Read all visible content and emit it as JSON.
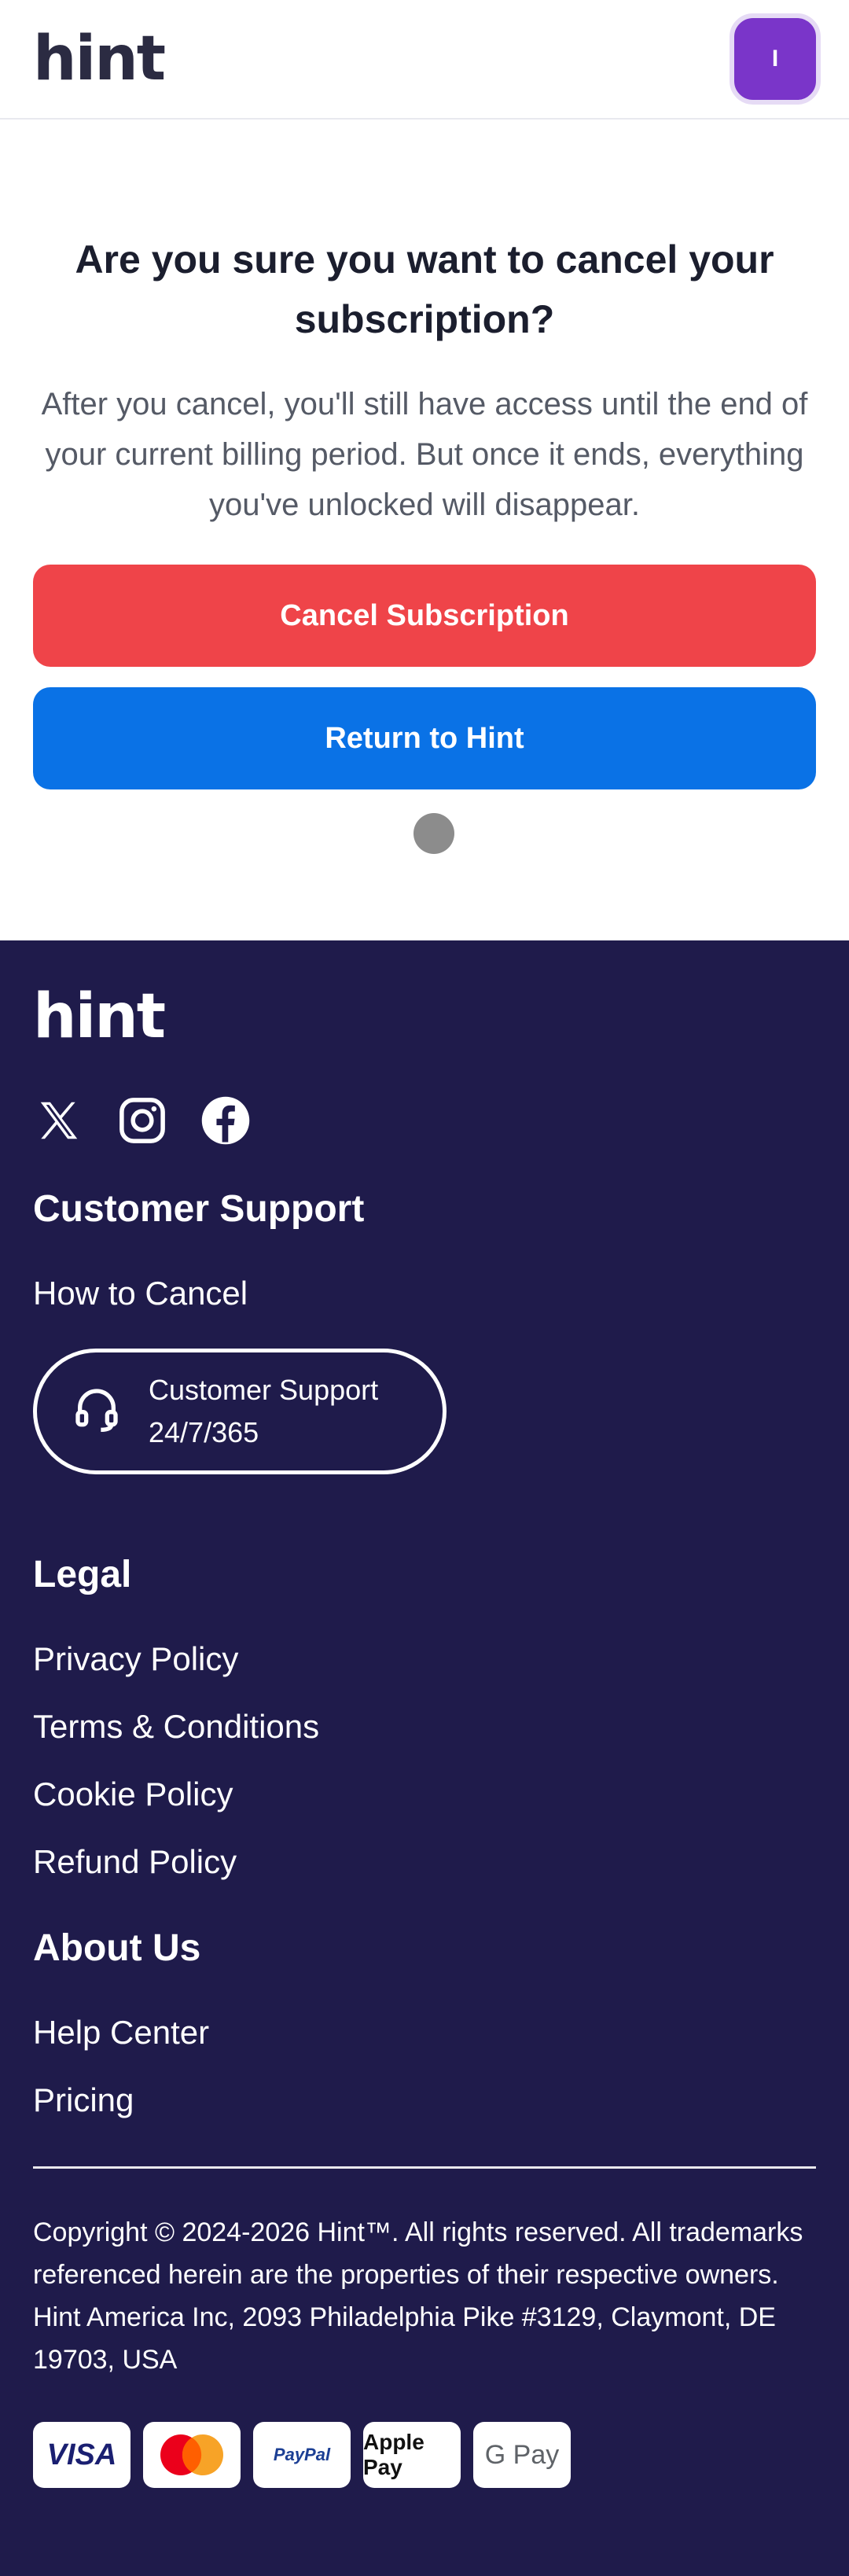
{
  "header": {
    "logo": "hint",
    "avatar_initial": "I"
  },
  "main": {
    "title": "Are you sure you want to cancel your subscription?",
    "description": "After you cancel, you'll still have access until the end of your current billing period. But once it ends, everything you've unlocked will disappear.",
    "cancel_button": "Cancel Subscription",
    "return_button": "Return to Hint"
  },
  "footer": {
    "logo": "hint",
    "socials": [
      "x-icon",
      "instagram-icon",
      "facebook-icon"
    ],
    "customer_support": {
      "heading": "Customer Support",
      "how_to_cancel": "How to Cancel",
      "pill_line1": "Customer Support",
      "pill_line2": "24/7/365"
    },
    "legal": {
      "heading": "Legal",
      "links": [
        "Privacy Policy",
        "Terms & Conditions",
        "Cookie Policy",
        "Refund Policy"
      ]
    },
    "about": {
      "heading": "About Us",
      "links": [
        "Help Center",
        "Pricing"
      ]
    },
    "copyright": "Copyright © 2024-2026 Hint™. All rights reserved. All trademarks referenced herein are the properties of their respective owners.",
    "address": "Hint America Inc, 2093 Philadelphia Pike #3129, Claymont, DE 19703, USA",
    "payments": [
      "VISA",
      "Mastercard",
      "PayPal",
      "Apple Pay",
      "G Pay"
    ]
  },
  "colors": {
    "cancel": "#ef4449",
    "return": "#0a72e6",
    "footer_bg": "#1f1b4b",
    "avatar": "#7a35c9"
  }
}
